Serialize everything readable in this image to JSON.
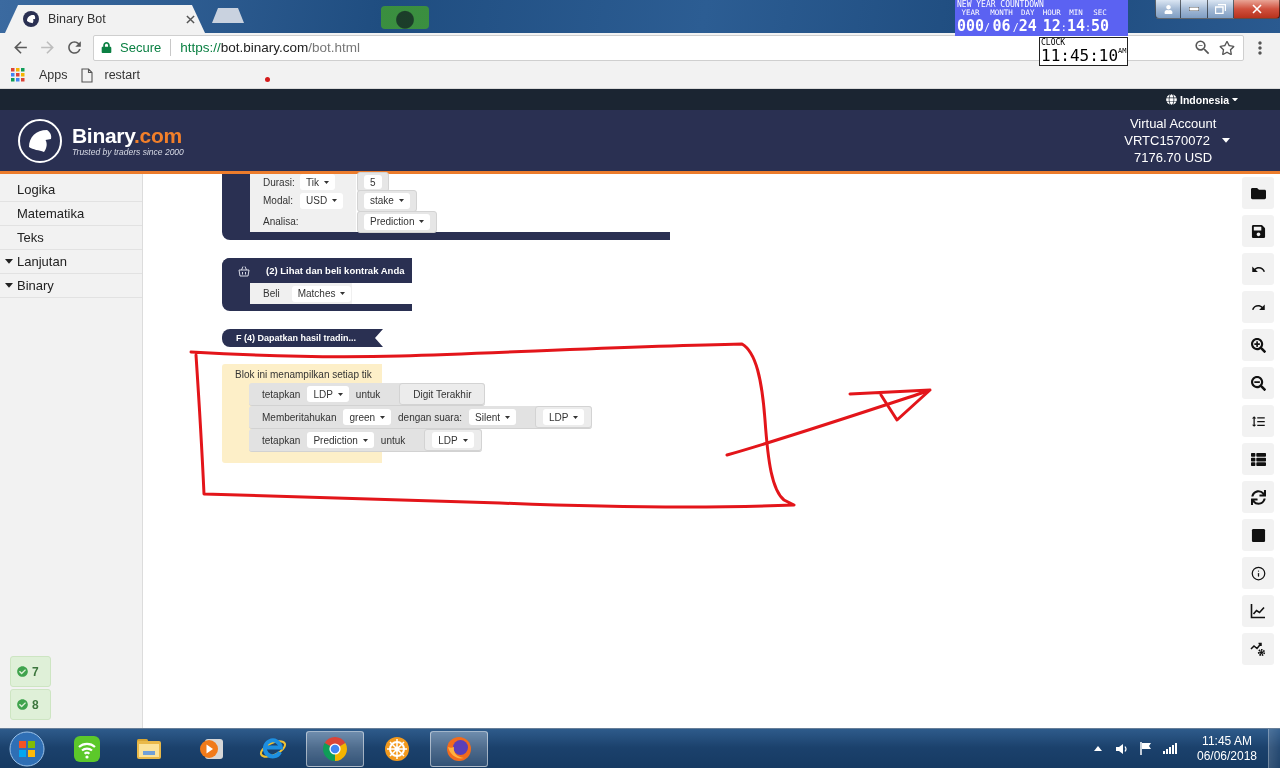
{
  "browser": {
    "tabs": [
      {
        "title": "Binary Bot",
        "selected": true
      }
    ],
    "nav_buttons": [
      {
        "kind": "back",
        "disabled": false
      },
      {
        "kind": "forward",
        "disabled": true
      },
      {
        "kind": "reload",
        "disabled": false
      }
    ],
    "address_bar": {
      "security": "Secure",
      "scheme": "https://",
      "host": "bot.binary.com",
      "path": "/bot.html"
    },
    "bookmarks": [
      {
        "kind": "apps",
        "label": "Apps"
      },
      {
        "kind": "page",
        "label": "restart"
      }
    ]
  },
  "gadgets": {
    "countdown": {
      "title": "NEW YEAR COUNTDOWN",
      "segments": [
        {
          "unit": "YEAR",
          "value": "000",
          "sep": "/"
        },
        {
          "unit": "MONTH",
          "value": "06",
          "sep": "/"
        },
        {
          "unit": "DAY",
          "value": "24"
        },
        {
          "unit": "HOUR",
          "value": "12",
          "sep": ":"
        },
        {
          "unit": "MIN",
          "value": "14",
          "sep": ":"
        },
        {
          "unit": "SEC",
          "value": "50"
        }
      ]
    },
    "clock": {
      "title": "CLOCK",
      "time": "11:45:10",
      "period": "AM"
    }
  },
  "site": {
    "language": "Indonesia",
    "brand": "Binary",
    "brand_suffix": ".com",
    "tagline": "Trusted by traders since 2000",
    "account": {
      "type": "Virtual Account",
      "id": "VRTC1570072",
      "balance": "7176.70 USD"
    }
  },
  "sidebar": {
    "categories": [
      {
        "kind": "item",
        "label": "Logika"
      },
      {
        "kind": "item",
        "label": "Matematika"
      },
      {
        "kind": "item",
        "label": "Teks"
      },
      {
        "kind": "group",
        "label": "Lanjutan"
      },
      {
        "kind": "group",
        "label": "Binary"
      }
    ],
    "badges": [
      {
        "count": "7"
      },
      {
        "count": "8"
      }
    ]
  },
  "workspace": {
    "blocks": [
      {
        "kind": "trade",
        "rows": [
          {
            "items": [
              {
                "kind": "label",
                "text": "Durasi:"
              },
              {
                "kind": "dropdown",
                "text": "Tik"
              },
              {
                "kind": "input",
                "items": [
                  {
                    "kind": "number",
                    "text": "5"
                  }
                ]
              }
            ]
          },
          {
            "items": [
              {
                "kind": "label",
                "text": "Modal:"
              },
              {
                "kind": "dropdown",
                "text": "USD"
              },
              {
                "kind": "input",
                "items": [
                  {
                    "kind": "dropdown",
                    "text": "stake"
                  }
                ]
              }
            ]
          },
          {
            "items": [
              {
                "kind": "label",
                "text": "Analisa:"
              },
              {
                "kind": "input",
                "items": [
                  {
                    "kind": "dropdown",
                    "text": "Prediction"
                  }
                ]
              }
            ]
          }
        ]
      },
      {
        "kind": "purchase",
        "title": "(2) Lihat dan beli kontrak Anda",
        "rows": [
          {
            "items": [
              {
                "kind": "label",
                "text": "Beli"
              },
              {
                "kind": "dropdown",
                "text": "Matches"
              }
            ]
          }
        ]
      },
      {
        "kind": "collapsed",
        "title": "F (4) Dapatkan hasil tradin..."
      },
      {
        "kind": "tick",
        "title": "Blok ini menampilkan setiap tik",
        "rows": [
          {
            "items": [
              {
                "kind": "label",
                "text": "tetapkan"
              },
              {
                "kind": "dropdown",
                "text": "LDP"
              },
              {
                "kind": "label",
                "text": "untuk"
              },
              {
                "kind": "input",
                "items": [
                  {
                    "kind": "label",
                    "text": "Digit Terakhir"
                  }
                ]
              }
            ]
          },
          {
            "items": [
              {
                "kind": "label",
                "text": "Memberitahukan"
              },
              {
                "kind": "dropdown",
                "text": "green"
              },
              {
                "kind": "label",
                "text": "dengan suara:"
              },
              {
                "kind": "dropdown",
                "text": "Silent"
              },
              {
                "kind": "input",
                "items": [
                  {
                    "kind": "dropdown",
                    "text": "LDP"
                  }
                ]
              }
            ]
          },
          {
            "items": [
              {
                "kind": "label",
                "text": "tetapkan"
              },
              {
                "kind": "dropdown",
                "text": "Prediction"
              },
              {
                "kind": "label",
                "text": "untuk"
              },
              {
                "kind": "input",
                "items": [
                  {
                    "kind": "dropdown",
                    "text": "LDP"
                  }
                ]
              }
            ]
          }
        ]
      }
    ]
  },
  "taskbar": {
    "apps": [
      {
        "kind": "network",
        "active": false
      },
      {
        "kind": "folder",
        "active": false
      },
      {
        "kind": "media",
        "active": false
      },
      {
        "kind": "ie",
        "active": false
      },
      {
        "kind": "chrome",
        "active": true
      },
      {
        "kind": "wheel",
        "active": false
      },
      {
        "kind": "firefox",
        "active": true
      }
    ],
    "clock": {
      "time": "11:45 AM",
      "date": "06/06/2018"
    }
  }
}
